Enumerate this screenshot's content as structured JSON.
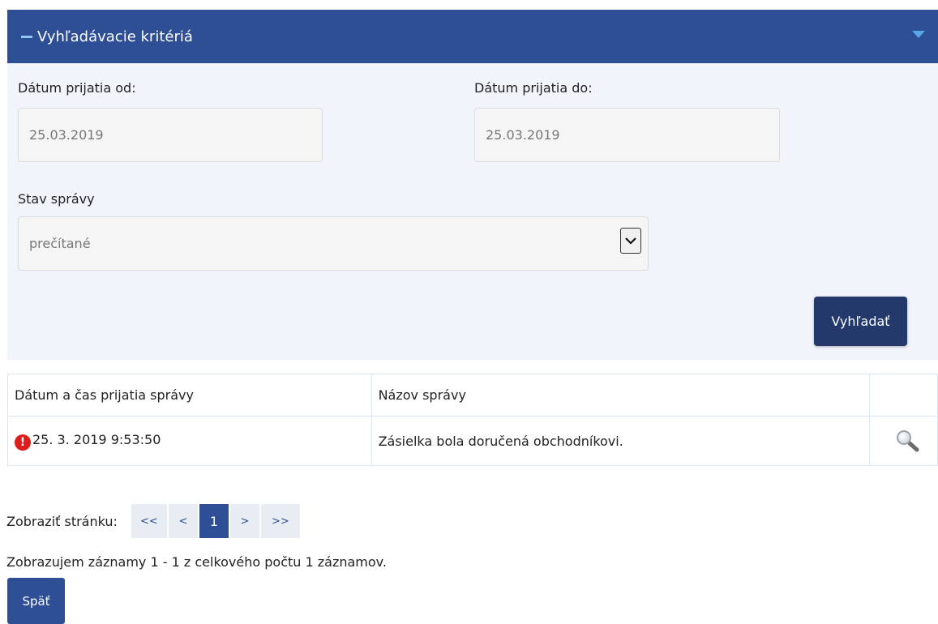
{
  "panel": {
    "title": "Vyhľadávacie kritériá"
  },
  "filters": {
    "date_from_label": "Dátum prijatia od:",
    "date_from_value": "25.03.2019",
    "date_to_label": "Dátum prijatia do:",
    "date_to_value": "25.03.2019",
    "status_label": "Stav správy",
    "status_value": "prečítané",
    "search_button": "Vyhľadať"
  },
  "table": {
    "columns": [
      "Dátum a čas prijatia správy",
      "Názov správy",
      ""
    ],
    "rows": [
      {
        "datetime": "25. 3. 2019 9:53:50",
        "name": "Zásielka bola doručená obchodníkovi.",
        "status_icon": "error-icon",
        "action_icon": "magnifier-icon"
      }
    ]
  },
  "pager": {
    "label": "Zobraziť stránku:",
    "first": "<<",
    "prev": "<",
    "current": "1",
    "next": ">",
    "last": ">>"
  },
  "summary": "Zobrazujem záznamy 1 - 1 z celkového počtu 1 záznamov.",
  "back_button": "Späť",
  "colors": {
    "header_bg": "#2e4e96",
    "panel_bg": "#f1f4fb",
    "button_bg": "#23396c",
    "error": "#e01b1b"
  }
}
